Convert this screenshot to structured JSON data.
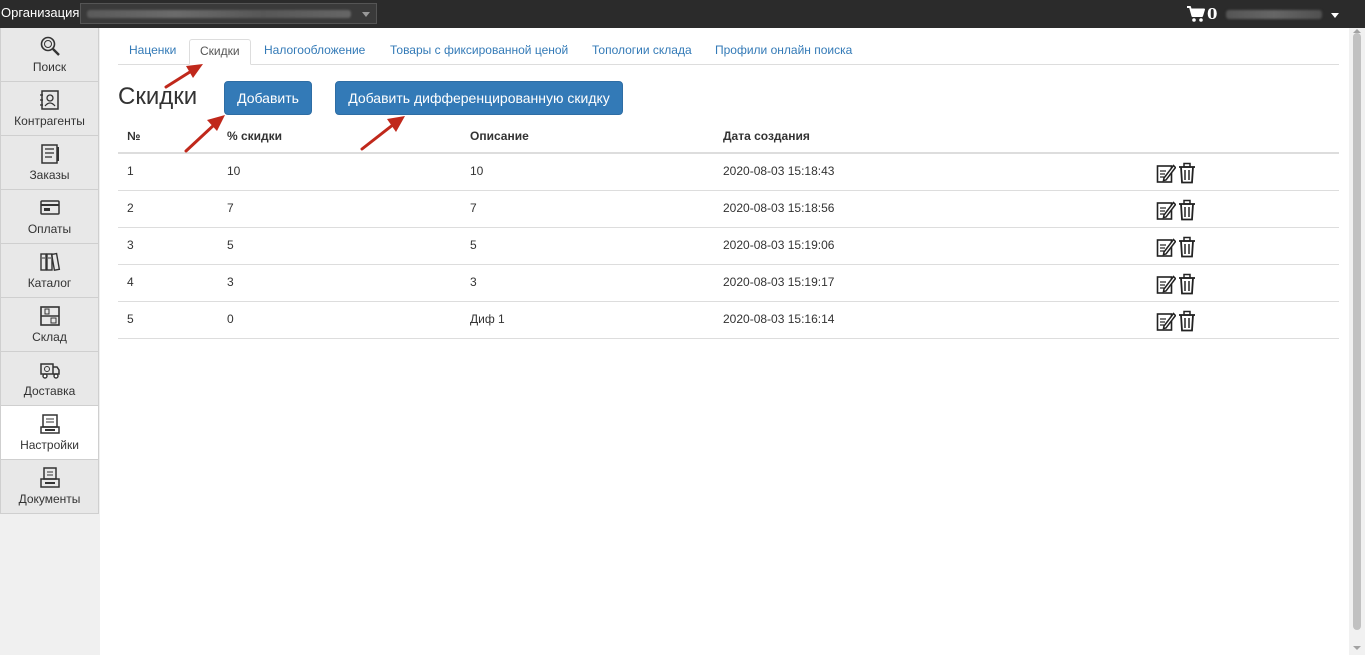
{
  "topbar": {
    "org_label": "Организация:",
    "cart_count": "0"
  },
  "sidebar": {
    "items": [
      {
        "label": "Поиск",
        "icon": "search-icon"
      },
      {
        "label": "Контрагенты",
        "icon": "contacts-icon"
      },
      {
        "label": "Заказы",
        "icon": "orders-icon"
      },
      {
        "label": "Оплаты",
        "icon": "payments-icon"
      },
      {
        "label": "Каталог",
        "icon": "catalog-icon"
      },
      {
        "label": "Склад",
        "icon": "warehouse-icon"
      },
      {
        "label": "Доставка",
        "icon": "delivery-icon"
      },
      {
        "label": "Настройки",
        "icon": "settings-icon",
        "active": true
      },
      {
        "label": "Документы",
        "icon": "documents-icon"
      }
    ]
  },
  "tabs": [
    {
      "label": "Наценки"
    },
    {
      "label": "Скидки",
      "active": true
    },
    {
      "label": "Налогообложение"
    },
    {
      "label": "Товары с фиксированной ценой"
    },
    {
      "label": "Топологии склада"
    },
    {
      "label": "Профили онлайн поиска"
    }
  ],
  "page": {
    "title": "Скидки",
    "add_button": "Добавить",
    "add_diff_button": "Добавить дифференцированную скидку"
  },
  "table": {
    "headers": [
      "№",
      "% скидки",
      "Описание",
      "Дата создания"
    ],
    "rows": [
      [
        "1",
        "10",
        "10",
        "2020-08-03 15:18:43"
      ],
      [
        "2",
        "7",
        "7",
        "2020-08-03 15:18:56"
      ],
      [
        "3",
        "5",
        "5",
        "2020-08-03 15:19:06"
      ],
      [
        "4",
        "3",
        "3",
        "2020-08-03 15:19:17"
      ],
      [
        "5",
        "0",
        "Диф 1",
        "2020-08-03 15:16:14"
      ]
    ],
    "row_actions": [
      "edit-icon",
      "delete-icon"
    ]
  },
  "colors": {
    "topbar": "#2b2b2b",
    "primary": "#337ab7",
    "link": "#337ab7",
    "annotation_arrow": "#c0281b"
  }
}
